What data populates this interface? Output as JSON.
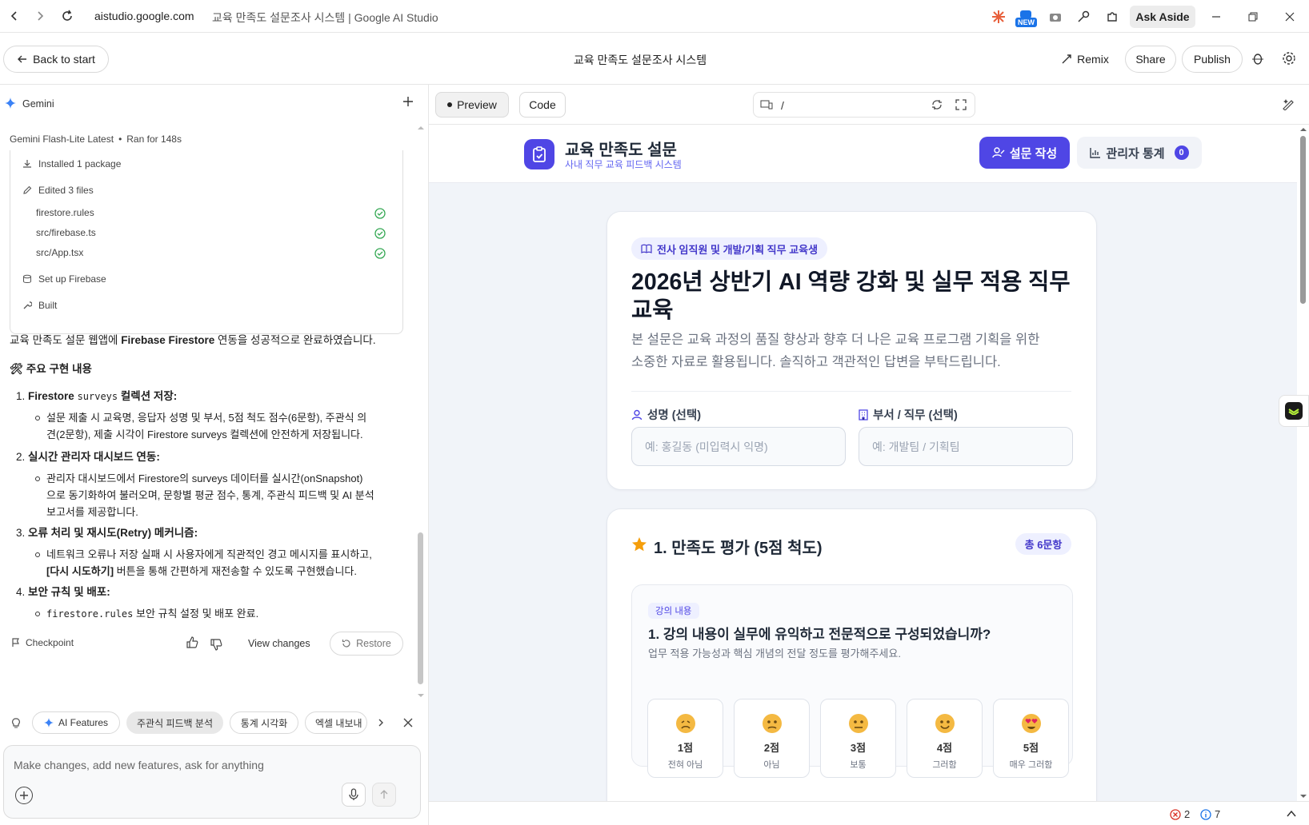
{
  "browser": {
    "url": "aistudio.google.com",
    "tab_title": "교육 만족도 설문조사 시스템 | Google AI Studio",
    "new_badge": "NEW",
    "ask_aside": "Ask Aside"
  },
  "header": {
    "back_label": "Back to start",
    "title": "교육 만족도 설문조사 시스템",
    "remix_label": "Remix",
    "share_label": "Share",
    "publish_label": "Publish"
  },
  "left": {
    "agent_name": "Gemini",
    "model_line": "Gemini Flash-Lite Latest",
    "run_line": "Ran for 148s",
    "steps": {
      "installed": "Installed 1 package",
      "edited": "Edited 3 files",
      "setup": "Set up Firebase",
      "built": "Built"
    },
    "files": [
      "firestore.rules",
      "src/firebase.ts",
      "src/App.tsx"
    ],
    "summary_pre": "교육 만족도 설문 웹앱에 ",
    "summary_bold": "Firebase Firestore",
    "summary_post": " 연동을 성공적으로 완료하였습니다.",
    "section_title": "🛠 주요 구현 내용",
    "items": [
      {
        "num": "1.",
        "title_pre": "Firestore ",
        "title_code": "surveys",
        "title_post": " 컬렉션 저장",
        "body_lines": [
          "설문 제출 시 교육명, 응답자 성명 및 부서, 5점 척도 점수(6문항), 주관식 의",
          "견(2문항), 제출 시각이 Firestore surveys 컬렉션에 안전하게 저장됩니다."
        ]
      },
      {
        "num": "2.",
        "title": "실시간 관리자 대시보드 연동",
        "body_lines": [
          "관리자 대시보드에서 Firestore의 surveys 데이터를 실시간(onSnapshot)",
          "으로 동기화하여 불러오며, 문항별 평균 점수, 통계, 주관식 피드백 및 AI 분석",
          "보고서를 제공합니다."
        ]
      },
      {
        "num": "3.",
        "title": "오류 처리 및 재시도(Retry) 메커니즘",
        "body_lines": [
          "네트워크 오류나 저장 실패 시 사용자에게 직관적인 경고 메시지를 표시하고,"
        ],
        "body_line2_bold": "[다시 시도하기]",
        "body_line2_rest": " 버튼을 통해 간편하게 재전송할 수 있도록 구현했습니다."
      },
      {
        "num": "4.",
        "title": "보안 규칙 및 배포",
        "body_code": "firestore.rules",
        "body_rest": " 보안 규칙 설정 및 배포 완료."
      }
    ],
    "checkpoint_label": "Checkpoint",
    "view_changes_label": "View changes",
    "restore_label": "Restore",
    "chips": [
      "AI Features",
      "주관식 피드백 분석",
      "통계 시각화",
      "엑셀 내보내"
    ],
    "composer_placeholder": "Make changes, add new features, ask for anything"
  },
  "right": {
    "preview_tab": "Preview",
    "code_tab": "Code",
    "path": "/",
    "app": {
      "brand_title": "교육 만족도 설문",
      "brand_sub": "사내 직무 교육 피드백 시스템",
      "nav_survey": "설문 작성",
      "nav_admin": "관리자 통계",
      "admin_count": "0",
      "target_badge": "전사 임직원 및 개발/기획 직무 교육생",
      "course_title_1": "2026년 상반기 AI 역량 강화 및 실무 적용 직무",
      "course_title_2": "교육",
      "intro_1": "본 설문은 교육 과정의 품질 향상과 향후 더 나은 교육 프로그램 기획을 위한",
      "intro_2": "소중한 자료로 활용됩니다. 솔직하고 객관적인 답변을 부탁드립니다.",
      "name_label": "성명 (선택)",
      "name_placeholder": "예: 홍길동 (미입력시 익명)",
      "dept_label": "부서 / 직무 (선택)",
      "dept_placeholder": "예: 개발팀 / 기획팀",
      "section_title": "1. 만족도 평가 (5점 척도)",
      "section_count": "총 6문항",
      "q_tag": "강의 내용",
      "q_title": "1. 강의 내용이 실무에 유익하고 전문적으로 구성되었습니까?",
      "q_desc": "업무 적용 가능성과 핵심 개념의 전달 정도를 평가해주세요.",
      "options": [
        {
          "score": "1점",
          "desc": "전혀 아님",
          "emoji": "sad-face-icon"
        },
        {
          "score": "2점",
          "desc": "아님",
          "emoji": "worried-face-icon"
        },
        {
          "score": "3점",
          "desc": "보통",
          "emoji": "neutral-face-icon"
        },
        {
          "score": "4점",
          "desc": "그러함",
          "emoji": "smile-face-icon"
        },
        {
          "score": "5점",
          "desc": "매우 그러함",
          "emoji": "heart-eyes-face-icon"
        }
      ]
    },
    "status": {
      "errors": "2",
      "infos": "7"
    }
  },
  "colors": {
    "accent": "#4f46e5",
    "accent_light": "#eef0ff",
    "star": "#f59e0b"
  }
}
